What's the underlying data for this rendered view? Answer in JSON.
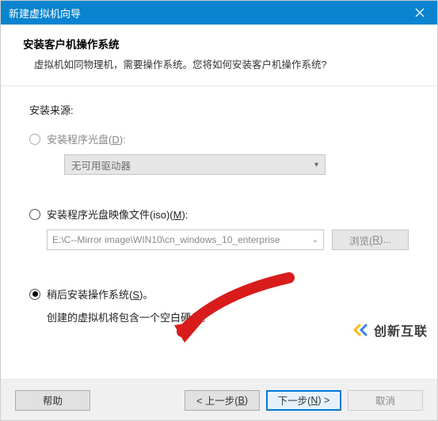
{
  "window": {
    "title": "新建虚拟机向导"
  },
  "header": {
    "title": "安装客户机操作系统",
    "desc": "虚拟机如同物理机，需要操作系统。您将如何安装客户机操作系统?"
  },
  "body": {
    "source_label": "安装来源:",
    "opt_disc_prefix": "安装程序光盘(",
    "opt_disc_key": "D",
    "opt_disc_suffix": "):",
    "dropdown_value": "无可用驱动器",
    "opt_iso_prefix": "安装程序光盘映像文件(iso)(",
    "opt_iso_key": "M",
    "opt_iso_suffix": "):",
    "iso_path": "E:\\C--Mirror image\\WIN10\\cn_windows_10_enterprise",
    "browse_prefix": "浏览(",
    "browse_key": "R",
    "browse_suffix": ")...",
    "opt_later_prefix": "稍后安装操作系统(",
    "opt_later_key": "S",
    "opt_later_suffix": ")。",
    "later_desc": "创建的虚拟机将包含一个空白硬盘。"
  },
  "footer": {
    "help": "帮助",
    "back_prefix": "< 上一步(",
    "back_key": "B",
    "back_suffix": ")",
    "next_prefix": "下一步(",
    "next_key": "N",
    "next_suffix": ") >",
    "cancel": "取消"
  },
  "watermark": {
    "text": "创新互联"
  }
}
